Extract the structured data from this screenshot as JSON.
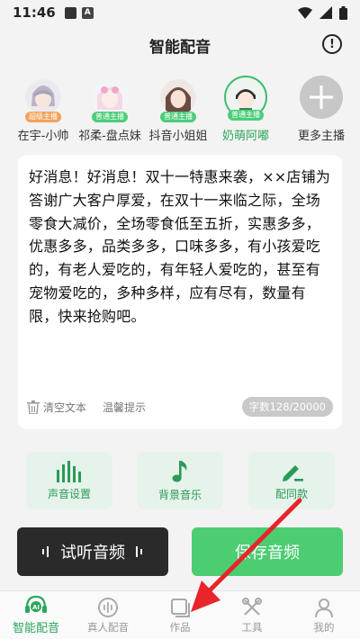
{
  "status_bar": {
    "time": "11:46",
    "icons": [
      "app-notification-icon",
      "a-notification-icon",
      "wifi-icon",
      "signal-icon",
      "battery-icon"
    ]
  },
  "header": {
    "title": "智能配音",
    "info_icon": "!"
  },
  "anchors": [
    {
      "name": "在宇-小帅",
      "badge": "超级主播",
      "badge_color": "#f2a25b",
      "selected": false
    },
    {
      "name": "祁柔-盘点妹",
      "badge": "普通主播",
      "badge_color": "#4ccd7a",
      "selected": false
    },
    {
      "name": "抖音小姐姐",
      "badge": "普通主播",
      "badge_color": "#4ccd7a",
      "selected": false
    },
    {
      "name": "奶萌阿嘟",
      "badge": "普通主播",
      "badge_color": "#4ccd7a",
      "selected": true
    },
    {
      "name": "更多主播",
      "badge": "",
      "selected": false
    }
  ],
  "editor": {
    "text": "好消息！好消息！双十一特惠来袭，××店铺为答谢广大客户厚爱，在双十一来临之际，全场零食大减价，全场零食低至五折，实惠多多，优惠多多，品类多多，口味多多，有小孩爱吃的，有老人爱吃的，有年轻人爱吃的，甚至有宠物爱吃的，多种多样，应有尽有，数量有限，快来抢购吧。",
    "clear_label": "清空文本",
    "tips_label": "温馨提示",
    "count_label": "字数128/20000"
  },
  "tools": [
    {
      "label": "声音设置",
      "icon": "sound-bars-icon"
    },
    {
      "label": "背景音乐",
      "icon": "music-note-icon"
    },
    {
      "label": "配同款",
      "icon": "edit-pen-icon"
    }
  ],
  "actions": {
    "listen_label": "试听音频",
    "save_label": "保存音频"
  },
  "tabbar": [
    {
      "label": "智能配音",
      "icon": "ai-voice-icon",
      "active": true
    },
    {
      "label": "真人配音",
      "icon": "waveform-icon",
      "active": false
    },
    {
      "label": "作品",
      "icon": "works-icon",
      "active": false
    },
    {
      "label": "工具",
      "icon": "tools-icon",
      "active": false
    },
    {
      "label": "我的",
      "icon": "user-icon",
      "active": false
    }
  ],
  "colors": {
    "accent": "#3dbd6c",
    "save_button": "#4ccd72",
    "listen_button": "#2a2a2a",
    "arrow": "#e8252a"
  }
}
